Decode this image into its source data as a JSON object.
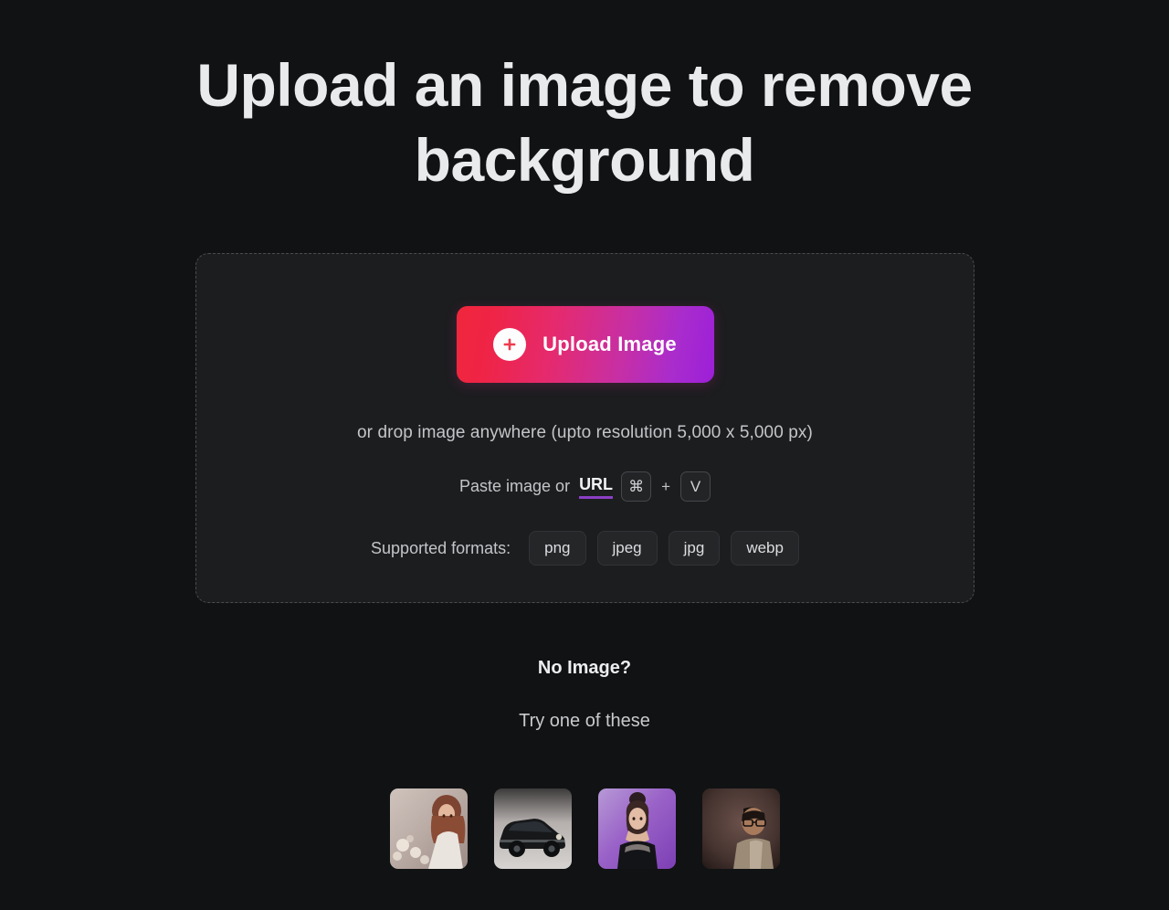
{
  "page": {
    "background_color": "#111214",
    "headline": "Upload an image to remove background"
  },
  "dropzone": {
    "upload_button": {
      "label": "Upload Image",
      "icon": "plus-circle-icon",
      "gradient_from": "#f0263c",
      "gradient_to": "#9c1fd8"
    },
    "drop_hint": "or drop image anywhere (upto resolution 5,000 x 5,000 px)",
    "paste": {
      "prefix": "Paste image or",
      "url_label": "URL",
      "url_underline_color": "#8b3fc4",
      "key_command": "⌘",
      "key_separator": "+",
      "key_letter": "V"
    },
    "formats": {
      "label": "Supported formats:",
      "items": [
        "png",
        "jpeg",
        "jpg",
        "webp"
      ]
    }
  },
  "samples": {
    "title": "No Image?",
    "subtitle": "Try one of these",
    "thumbnails": [
      {
        "name": "sample-woman-bokeh",
        "alt": "woman with auburn hair and bokeh lights"
      },
      {
        "name": "sample-classic-car",
        "alt": "dark classic car on gray studio backdrop"
      },
      {
        "name": "sample-woman-purple",
        "alt": "woman in black on purple gradient background"
      },
      {
        "name": "sample-man-glasses",
        "alt": "man with glasses on dark brown backdrop"
      }
    ]
  }
}
